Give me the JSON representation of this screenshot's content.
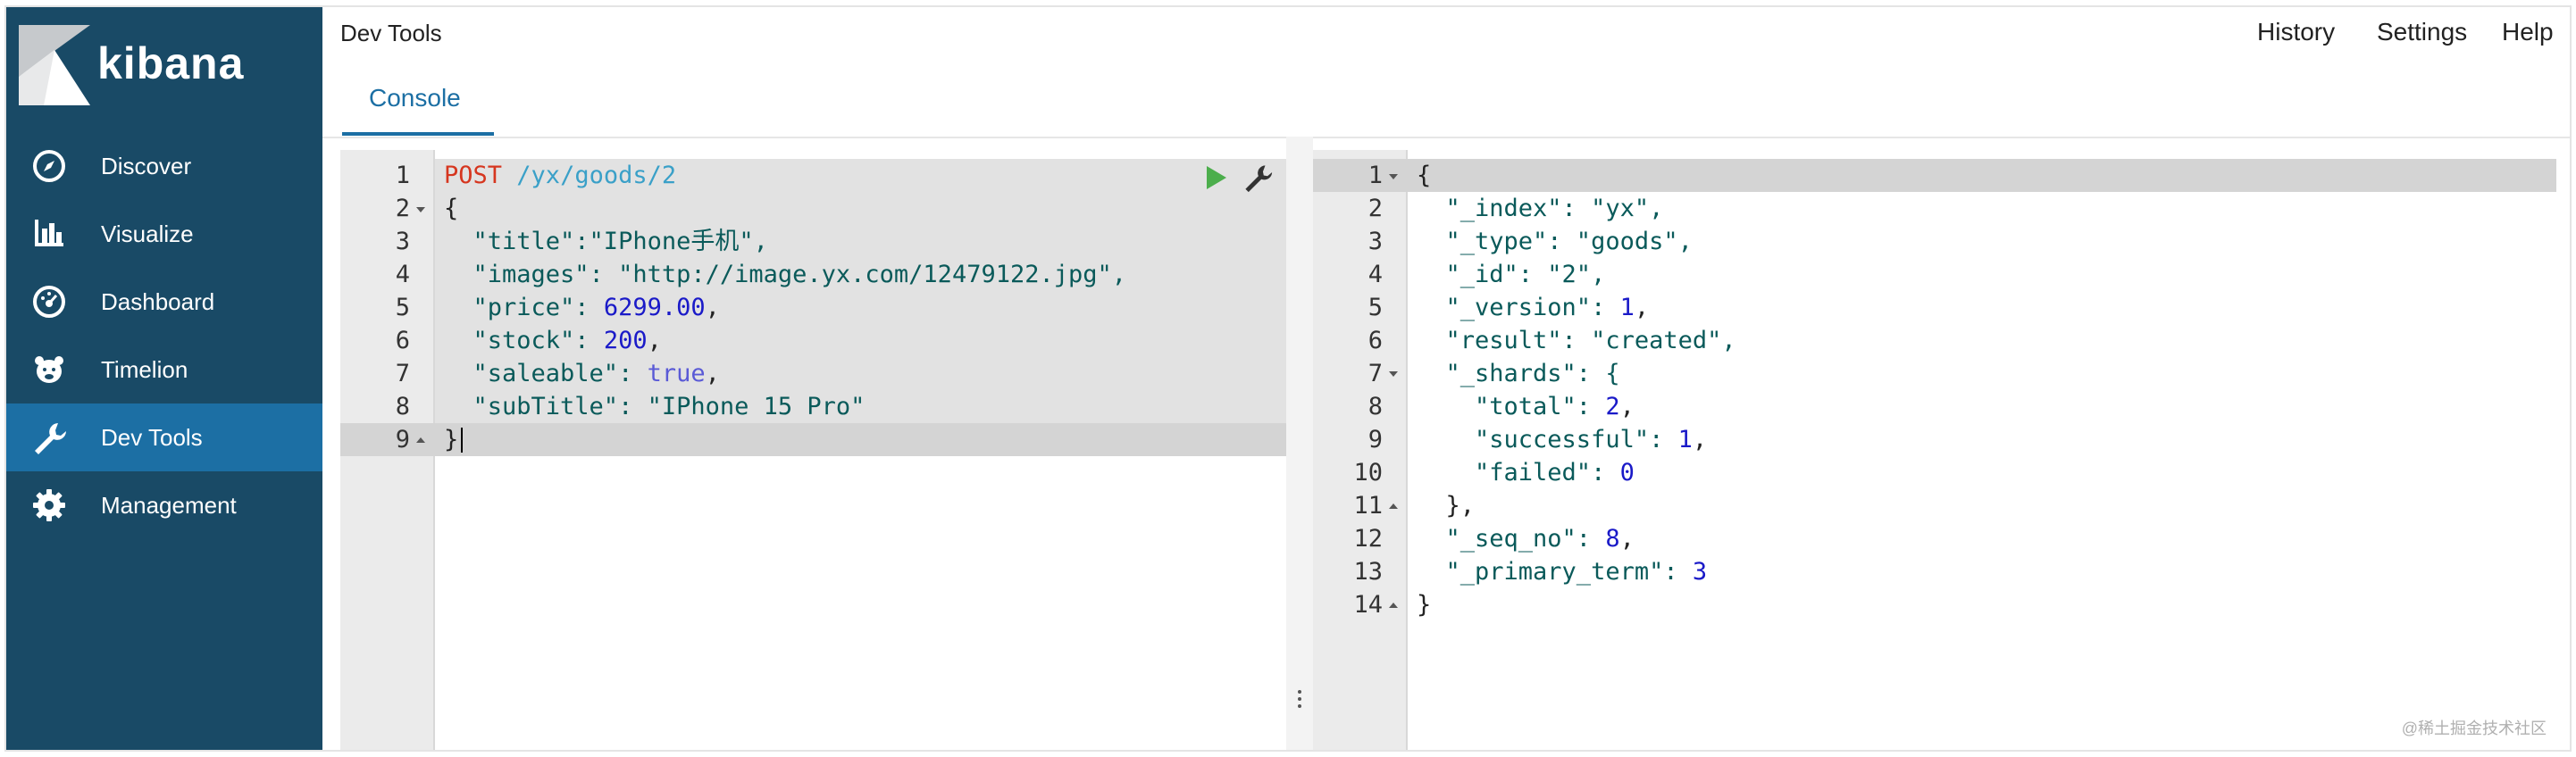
{
  "app": {
    "brand": "kibana"
  },
  "sidebar": {
    "items": [
      {
        "label": "Discover",
        "icon": "compass-icon"
      },
      {
        "label": "Visualize",
        "icon": "bar-chart-icon"
      },
      {
        "label": "Dashboard",
        "icon": "dashboard-icon"
      },
      {
        "label": "Timelion",
        "icon": "bear-icon"
      },
      {
        "label": "Dev Tools",
        "icon": "wrench-icon",
        "active": true
      },
      {
        "label": "Management",
        "icon": "gear-icon"
      }
    ]
  },
  "header": {
    "breadcrumb": "Dev Tools",
    "menu": {
      "history": "History",
      "settings": "Settings",
      "help": "Help"
    },
    "tab": "Console"
  },
  "request": {
    "method": "POST",
    "path": "/yx/goods/2",
    "lines": [
      "{",
      "  \"title\":\"IPhone手机\",",
      "  \"images\": \"http://image.yx.com/12479122.jpg\",",
      "  \"price\": 6299.00,",
      "  \"stock\": 200,",
      "  \"saleable\": true,",
      "  \"subTitle\": \"IPhone 15 Pro\"",
      "}"
    ]
  },
  "response": {
    "lines": [
      "{",
      "  \"_index\": \"yx\",",
      "  \"_type\": \"goods\",",
      "  \"_id\": \"2\",",
      "  \"_version\": 1,",
      "  \"result\": \"created\",",
      "  \"_shards\": {",
      "    \"total\": 2,",
      "    \"successful\": 1,",
      "    \"failed\": 0",
      "  },",
      "  \"_seq_no\": 8,",
      "  \"_primary_term\": 3",
      "}"
    ]
  },
  "watermark": "@稀土掘金技术社区",
  "colors": {
    "sidebar": "#194a66",
    "active": "#1c6fa4",
    "play": "#4cae4c"
  }
}
